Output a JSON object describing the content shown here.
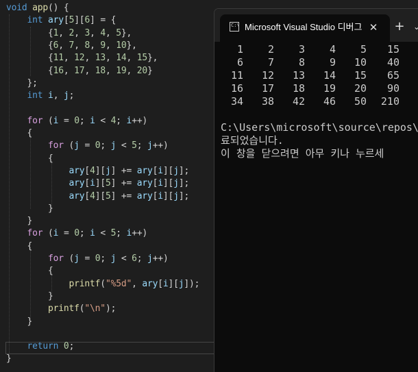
{
  "code": {
    "lines": [
      "void app() {",
      "    int ary[5][6] = {",
      "        {1, 2, 3, 4, 5},",
      "        {6, 7, 8, 9, 10},",
      "        {11, 12, 13, 14, 15},",
      "        {16, 17, 18, 19, 20}",
      "    };",
      "    int i, j;",
      "",
      "    for (i = 0; i < 4; i++)",
      "    {",
      "        for (j = 0; j < 5; j++)",
      "        {",
      "            ary[4][j] += ary[i][j];",
      "            ary[i][5] += ary[i][j];",
      "            ary[4][5] += ary[i][j];",
      "        }",
      "    }",
      "    for (i = 0; i < 5; i++)",
      "    {",
      "        for (j = 0; j < 6; j++)",
      "        {",
      "            printf(\"%5d\", ary[i][j]);",
      "        }",
      "        printf(\"\\n\");",
      "    }",
      "",
      "    return 0;",
      "}"
    ]
  },
  "terminal": {
    "tab_title": "Microsoft Visual Studio 디버그",
    "icon_text": "C:\\",
    "close_glyph": "✕",
    "new_tab_glyph": "+",
    "dropdown_glyph": "⌄",
    "output_rows": [
      [
        "1",
        "2",
        "3",
        "4",
        "5",
        "15"
      ],
      [
        "6",
        "7",
        "8",
        "9",
        "10",
        "40"
      ],
      [
        "11",
        "12",
        "13",
        "14",
        "15",
        "65"
      ],
      [
        "16",
        "17",
        "18",
        "19",
        "20",
        "90"
      ],
      [
        "34",
        "38",
        "42",
        "46",
        "50",
        "210"
      ]
    ],
    "path_line": "C:\\Users\\microsoft\\source\\repos\\",
    "message_line1": "료되었습니다.",
    "message_line2": "이 창을 닫으려면 아무 키나 누르세"
  }
}
